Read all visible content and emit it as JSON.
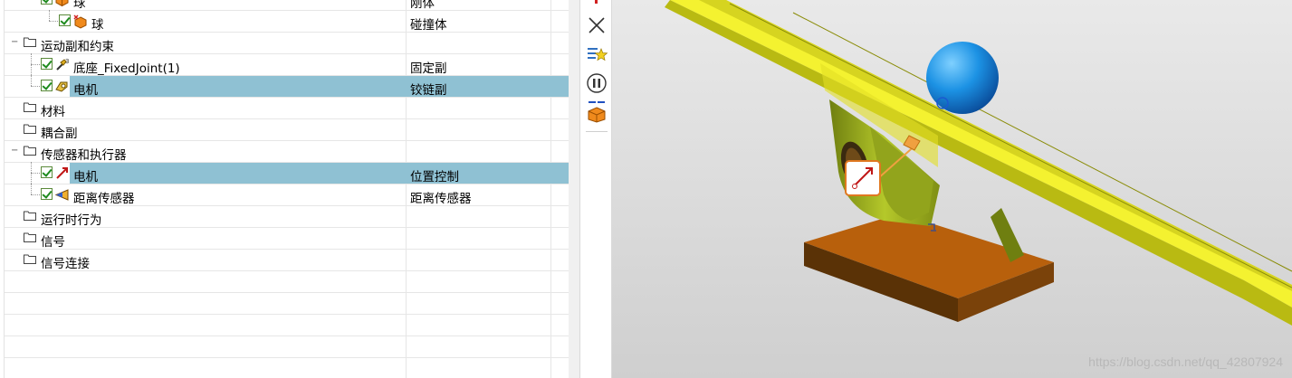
{
  "tree": {
    "rows": [
      {
        "label": "球",
        "type": "刚体"
      },
      {
        "label": "球",
        "type": "碰撞体"
      },
      {
        "label": "运动副和约束",
        "type": ""
      },
      {
        "label": "底座_FixedJoint(1)",
        "type": "固定副"
      },
      {
        "label": "电机",
        "type": "铰链副"
      },
      {
        "label": "材料",
        "type": ""
      },
      {
        "label": "耦合副",
        "type": ""
      },
      {
        "label": "传感器和执行器",
        "type": ""
      },
      {
        "label": "电机",
        "type": "位置控制"
      },
      {
        "label": "距离传感器",
        "type": "距离传感器"
      },
      {
        "label": "运行时行为",
        "type": ""
      },
      {
        "label": "信号",
        "type": ""
      },
      {
        "label": "信号连接",
        "type": ""
      }
    ]
  },
  "toolbar": {
    "icons": [
      "close-icon",
      "star-list-icon",
      "pause-icon",
      "box-arrow-icon"
    ]
  },
  "viewport": {
    "watermark": "https://blog.csdn.net/qq_42807924",
    "colors": {
      "beam": "#f4f230",
      "ball": "#1a8fe0",
      "base": "#b8600c",
      "support": "#b2c52a",
      "background": "#d9d9d9"
    }
  }
}
